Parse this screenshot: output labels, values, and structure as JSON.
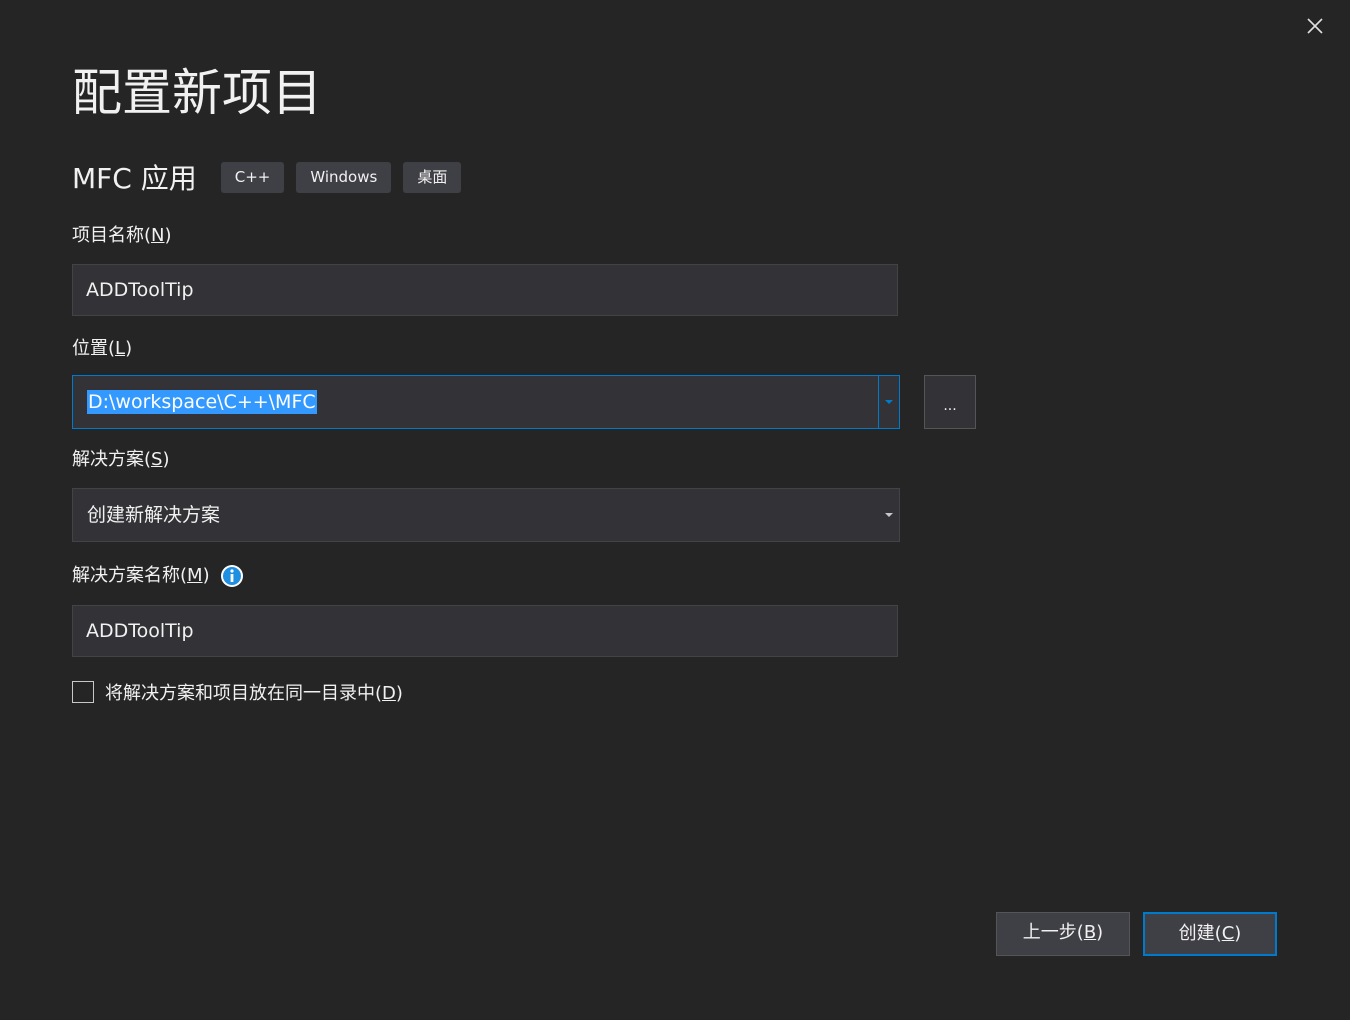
{
  "dialog": {
    "title": "配置新项目",
    "close_icon": "close-icon"
  },
  "template": {
    "name": "MFC 应用",
    "tags": [
      "C++",
      "Windows",
      "桌面"
    ]
  },
  "project_name": {
    "label": "项目名称(",
    "mnemonic": "N",
    "label_end": ")",
    "value": "ADDToolTip"
  },
  "location": {
    "label": "位置(",
    "mnemonic": "L",
    "label_end": ")",
    "value": "D:\\workspace\\C++\\MFC",
    "browse_label": "..."
  },
  "solution": {
    "label": "解决方案(",
    "mnemonic": "S",
    "label_end": ")",
    "value": "创建新解决方案"
  },
  "solution_name": {
    "label": "解决方案名称(",
    "mnemonic": "M",
    "label_end": ")",
    "value": "ADDToolTip",
    "info_icon": "info-icon"
  },
  "same_dir": {
    "label": "将解决方案和项目放在同一目录中(",
    "mnemonic": "D",
    "label_end": ")",
    "checked": false
  },
  "buttons": {
    "back_label": "上一步(",
    "back_mnemonic": "B",
    "back_end": ")",
    "create_label": "创建(",
    "create_mnemonic": "C",
    "create_end": ")"
  },
  "colors": {
    "background": "#252526",
    "input_background": "#333337",
    "accent": "#007acc",
    "selection": "#3399ff",
    "tag_background": "#3f3f46",
    "info_blue": "#1e8fe1"
  }
}
